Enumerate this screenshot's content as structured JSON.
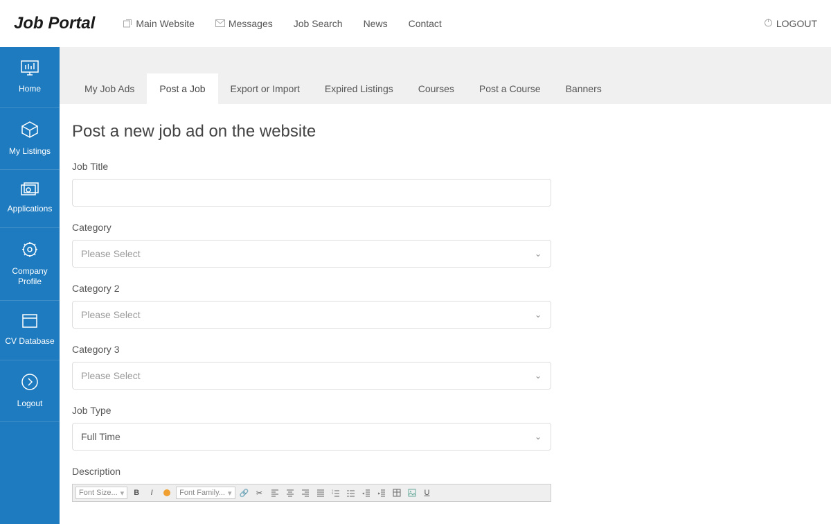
{
  "header": {
    "logo": "Job Portal",
    "nav": [
      {
        "label": "Main Website",
        "icon": "external"
      },
      {
        "label": "Messages",
        "icon": "mail"
      },
      {
        "label": "Job Search",
        "icon": ""
      },
      {
        "label": "News",
        "icon": ""
      },
      {
        "label": "Contact",
        "icon": ""
      }
    ],
    "logout": "LOGOUT"
  },
  "sidebar": {
    "items": [
      {
        "label": "Home"
      },
      {
        "label": "My Listings"
      },
      {
        "label": "Applications"
      },
      {
        "label": "Company Profile"
      },
      {
        "label": "CV Database"
      },
      {
        "label": "Logout"
      }
    ]
  },
  "tabs": {
    "items": [
      {
        "label": "My Job Ads"
      },
      {
        "label": "Post a Job"
      },
      {
        "label": "Export or Import"
      },
      {
        "label": "Expired Listings"
      },
      {
        "label": "Courses"
      },
      {
        "label": "Post a Course"
      },
      {
        "label": "Banners"
      }
    ],
    "active_index": 1
  },
  "form": {
    "title": "Post a new job ad on the website",
    "job_title_label": "Job Title",
    "job_title_value": "",
    "category_label": "Category",
    "category_value": "Please Select",
    "category2_label": "Category 2",
    "category2_value": "Please Select",
    "category3_label": "Category 3",
    "category3_value": "Please Select",
    "job_type_label": "Job Type",
    "job_type_value": "Full Time",
    "description_label": "Description"
  },
  "editor": {
    "font_size_label": "Font Size...",
    "font_family_label": "Font Family..."
  }
}
